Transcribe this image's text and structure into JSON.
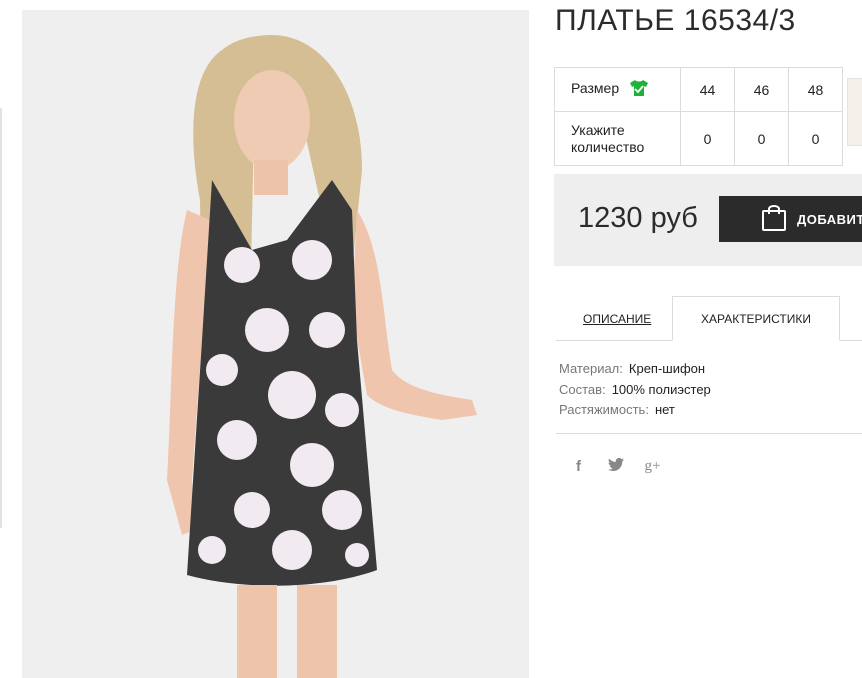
{
  "product": {
    "title": "ПЛАТЬЕ 16534/3",
    "image_alt": "product-photo"
  },
  "sizes": {
    "size_label": "Размер",
    "qty_label": "Укажите количество",
    "columns": [
      "44",
      "46",
      "48"
    ],
    "quantities": [
      "0",
      "0",
      "0"
    ]
  },
  "purchase": {
    "price": "1230 руб",
    "add_button": "ДОБАВИТЬ"
  },
  "tabs": {
    "description": "ОПИСАНИЕ",
    "characteristics": "ХАРАКТЕРИСТИКИ"
  },
  "specs": [
    {
      "key": "Материал:",
      "value": "Креп-шифон"
    },
    {
      "key": "Состав:",
      "value": "100% полиэстер"
    },
    {
      "key": "Растяжимость:",
      "value": "нет"
    }
  ],
  "social": {
    "facebook": "f",
    "twitter": "twitter-icon",
    "google": "g+"
  },
  "colors": {
    "dark": "#2b2b2b",
    "price_bg": "#eeeeee",
    "accent_green": "#1db33b"
  }
}
